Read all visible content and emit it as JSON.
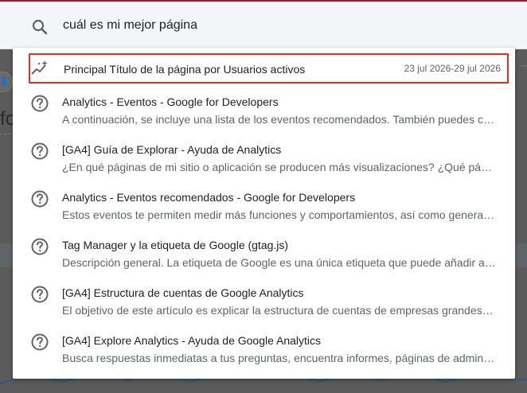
{
  "search": {
    "query": "cuál es mi mejor página"
  },
  "background": {
    "partial_text": "fo"
  },
  "suggestions": {
    "top_result": {
      "title": "Principal Título de la página por Usuarios activos",
      "date_range": "23 jul 2026-29 jul 2026",
      "icon": "insights-icon",
      "highlight_color": "#d93025"
    },
    "results": [
      {
        "title": "Analytics - Eventos - Google for Developers",
        "description": "A continuación, se incluye una lista de los eventos recomendados. También puedes crear eventos personalizados.",
        "icon": "help-circle-icon"
      },
      {
        "title": "[GA4] Guía de Explorar - Ayuda de Analytics",
        "description": "¿En qué páginas de mi sitio o aplicación se producen más visualizaciones? ¿Qué páginas tienen más interacción?",
        "icon": "help-circle-icon"
      },
      {
        "title": "Analytics - Eventos recomendados - Google for Developers",
        "description": "Estos eventos te permiten medir más funciones y comportamientos, así como generar informes más útiles.",
        "icon": "help-circle-icon"
      },
      {
        "title": "Tag Manager y la etiqueta de Google (gtag.js)",
        "description": "Descripción general. La etiqueta de Google es una única etiqueta que puede añadir a su sitio web.",
        "icon": "help-circle-icon"
      },
      {
        "title": "[GA4] Estructura de cuentas de Google Analytics",
        "description": "El objetivo de este artículo es explicar la estructura de cuentas de empresas grandes. Las cuentas de Analytics",
        "icon": "help-circle-icon"
      },
      {
        "title": "[GA4] Explore Analytics - Ayuda de Google Analytics",
        "description": "Busca respuestas inmediatas a tus preguntas, encuentra informes, páginas de administración y artículos de ayuda.",
        "icon": "help-circle-icon"
      }
    ]
  }
}
